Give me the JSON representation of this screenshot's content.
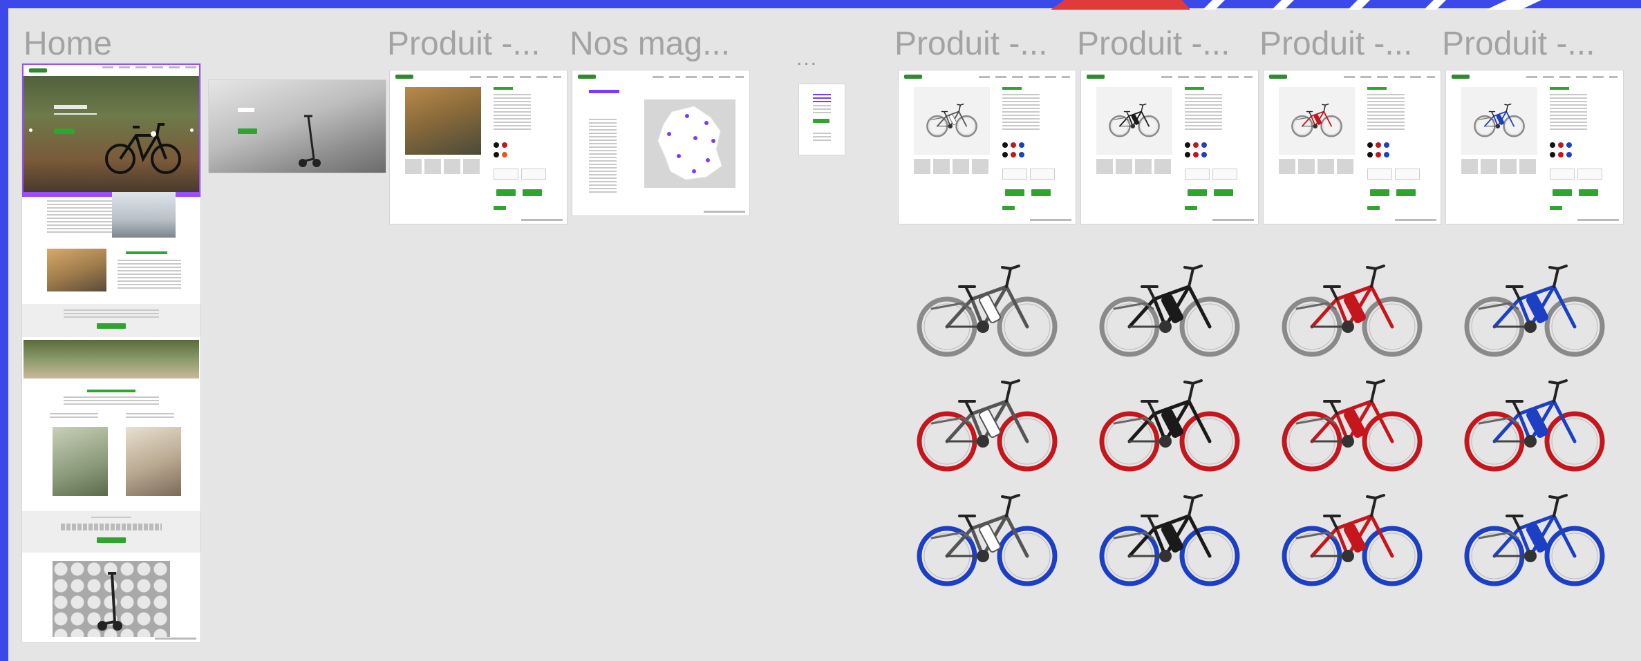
{
  "frames": [
    {
      "id": "home",
      "label": "Home",
      "selected": true
    },
    {
      "id": "produit-1",
      "label": "Produit -..."
    },
    {
      "id": "nos-magasins",
      "label": "Nos mag..."
    },
    {
      "id": "ellipsis",
      "label": "..."
    },
    {
      "id": "produit-2",
      "label": "Produit -..."
    },
    {
      "id": "produit-3",
      "label": "Produit -..."
    },
    {
      "id": "produit-4",
      "label": "Produit -..."
    },
    {
      "id": "produit-5",
      "label": "Produit -..."
    }
  ],
  "colors": {
    "canvas_bg": "#e5e5e5",
    "border_blue": "#3b49ea",
    "selection_purple": "#9b4dff",
    "accent_green": "#2fa52f",
    "bike_white": "#ffffff",
    "bike_black": "#1a1a1a",
    "bike_red": "#c4161c",
    "bike_blue": "#1d3fc4"
  },
  "bike_variants": {
    "frame_colors": [
      "white",
      "black",
      "red",
      "blue"
    ],
    "wheel_colors": [
      "gray",
      "red",
      "blue"
    ]
  }
}
